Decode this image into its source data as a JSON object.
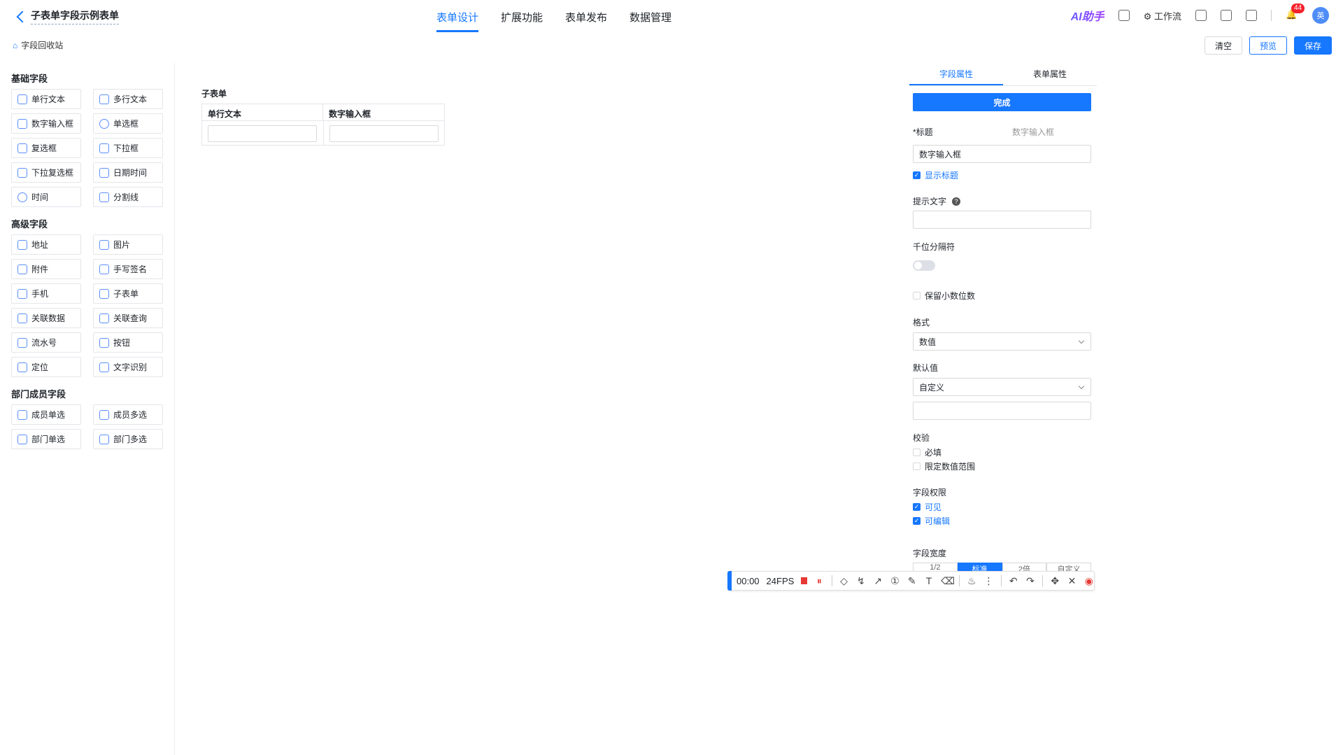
{
  "header": {
    "form_title": "子表单字段示例表单",
    "tabs": [
      "表单设计",
      "扩展功能",
      "表单发布",
      "数据管理"
    ],
    "ai_label": "AI助手",
    "workflow_label": "工作流",
    "notification_count": "44",
    "avatar_text": "英"
  },
  "toolbar": {
    "recycle_label": "字段回收站",
    "clear_label": "清空",
    "preview_label": "预览",
    "save_label": "保存"
  },
  "field_groups": [
    {
      "title": "基础字段",
      "items": [
        "单行文本",
        "多行文本",
        "数字输入框",
        "单选框",
        "复选框",
        "下拉框",
        "下拉复选框",
        "日期时间",
        "时间",
        "分割线"
      ]
    },
    {
      "title": "高级字段",
      "items": [
        "地址",
        "图片",
        "附件",
        "手写签名",
        "手机",
        "子表单",
        "关联数据",
        "关联查询",
        "流水号",
        "按钮",
        "定位",
        "文字识别"
      ]
    },
    {
      "title": "部门成员字段",
      "items": [
        "成员单选",
        "成员多选",
        "部门单选",
        "部门多选"
      ]
    }
  ],
  "canvas": {
    "subform_title": "子表单",
    "columns": [
      "单行文本",
      "数字输入框"
    ]
  },
  "properties": {
    "tabs": [
      "字段属性",
      "表单属性"
    ],
    "done_label": "完成",
    "title_label": "*标题",
    "title_hint": "数字输入框",
    "title_value": "数字输入框",
    "show_title_label": "显示标题",
    "placeholder_label": "提示文字",
    "thousands_label": "千位分隔符",
    "decimal_label": "保留小数位数",
    "format_label": "格式",
    "format_value": "数值",
    "default_label": "默认值",
    "default_value": "自定义",
    "validation_label": "校验",
    "required_label": "必填",
    "range_label": "限定数值范围",
    "permission_label": "字段权限",
    "visible_label": "可见",
    "editable_label": "可编辑",
    "width_label": "字段宽度",
    "width_options": [
      "1/2",
      "标准",
      "2倍",
      "自定义"
    ]
  },
  "recorder": {
    "time": "00:00",
    "fps": "24FPS"
  }
}
